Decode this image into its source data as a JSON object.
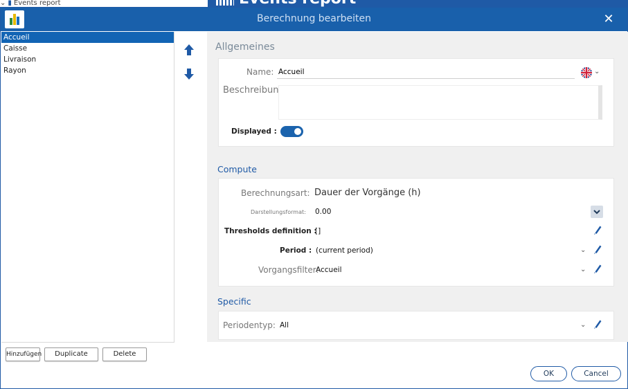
{
  "background": {
    "tree_item": "Events report",
    "header_title": "Events report"
  },
  "dialog": {
    "title": "Berechnung bearbeiten",
    "close_glyph": "✕"
  },
  "list": {
    "items": [
      "Accueil",
      "Caisse",
      "Livraison",
      "Rayon"
    ],
    "selected_index": 0
  },
  "buttons": {
    "add": "Hinzufügen",
    "duplicate": "Duplicate",
    "delete": "Delete",
    "ok": "OK",
    "cancel": "Cancel"
  },
  "general": {
    "section_title": "Allgemeines",
    "name_label": "Name:",
    "name_value": "Accueil",
    "description_label": "Beschreibung:",
    "description_value": "",
    "displayed_label": "Displayed :",
    "displayed_on": true,
    "language_flag": "uk-flag-icon"
  },
  "compute": {
    "section_title": "Compute",
    "calc_type_label": "Berechnungsart:",
    "calc_type_value": "Dauer der Vorgänge (h)",
    "format_label": "Darstellungsformat:",
    "format_value": "0.00",
    "thresholds_label": "Thresholds definition :",
    "thresholds_value": "[]",
    "period_label": "Period :",
    "period_value": "(current period)",
    "filter_label": "Vorgangsfilter:",
    "filter_value": "Accueil"
  },
  "specific": {
    "section_title": "Specific",
    "period_type_label": "Periodentyp:",
    "period_type_value": "All"
  },
  "colors": {
    "accent": "#1960ab",
    "selected_row": "#1264b4",
    "panel_bg": "#f0f0f0"
  }
}
